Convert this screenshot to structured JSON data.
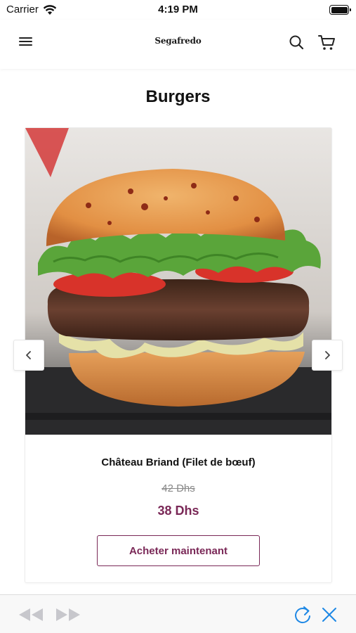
{
  "status_bar": {
    "carrier": "Carrier",
    "time": "4:19 PM",
    "icons": [
      "wifi-icon",
      "battery-icon"
    ]
  },
  "header": {
    "brand": "Segafredo",
    "icons": [
      "menu-icon",
      "search-icon",
      "cart-icon"
    ]
  },
  "page": {
    "title": "Burgers"
  },
  "product": {
    "name": "Château Briand (Filet de bœuf)",
    "old_price": "42 Dhs",
    "price": "38 Dhs",
    "buy_label": "Acheter maintenant",
    "image_icon": "burger-photo"
  },
  "carousel": {
    "icons": [
      "chevron-left-icon",
      "chevron-right-icon"
    ]
  },
  "toolbar": {
    "icons": [
      "back-icon",
      "forward-icon",
      "reload-icon",
      "close-icon"
    ]
  },
  "colors": {
    "accent": "#7a2857",
    "toolbar_icon_active": "#1e88e5",
    "toolbar_icon_disabled": "#c7c7cc"
  }
}
